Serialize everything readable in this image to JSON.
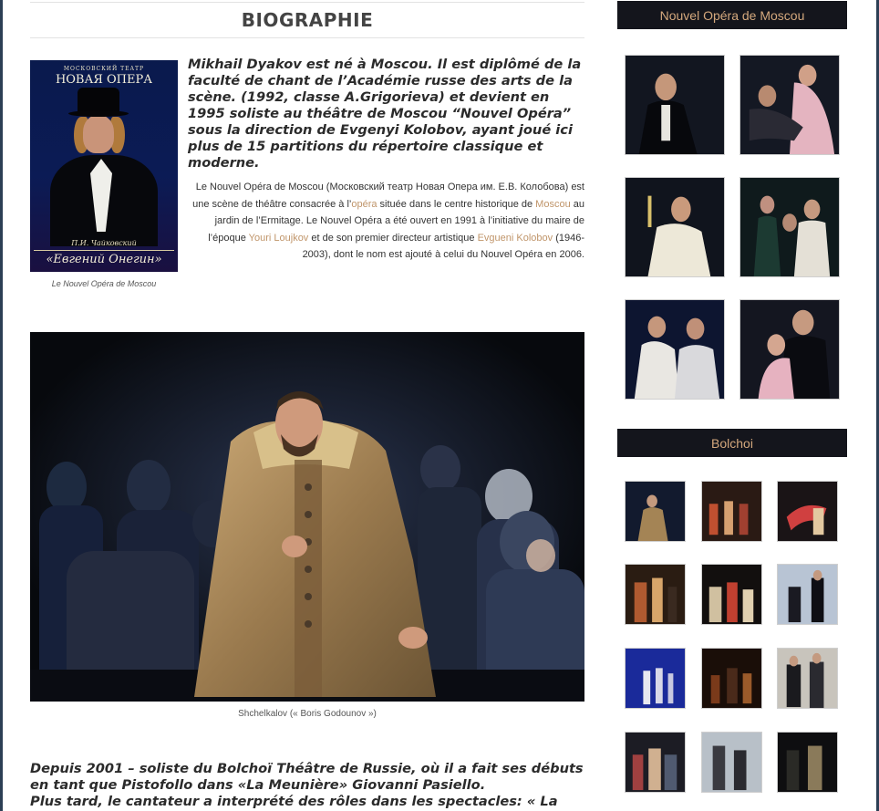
{
  "page": {
    "title": "BIOGRAPHIE"
  },
  "poster": {
    "top_line": "МОСКОВСКИЙ ТЕАТР",
    "title": "НОВАЯ ОПЕРА",
    "composer": "П.И. Чайковский",
    "opera": "«Евгений Онегин»",
    "caption": "Le Nouvel Opéra de Moscou"
  },
  "intro": {
    "lead": "Mikhail Dyakov est né à Moscou. Il est diplômé de la faculté de chant de l’Académie russe des arts de la scène. (1992, classe A.Grigorieva) et devient en 1995 soliste au théâtre de Moscou “Nouvel Opéra” sous la direction de Evgenyi Kolobov, ayant joué ici plus de 15 partitions du répertoire classique et moderne.",
    "desc_1": "Le Nouvel Opéra de Moscou (Московский театр Новая Опера им. Е.В. Колобова) est une scène de théâtre consacrée à l’",
    "link_opera": "opéra",
    "desc_2": " située dans le centre historique de ",
    "link_moscou": "Moscou",
    "desc_3": " au jardin de l’Ermitage. Le Nouvel Opéra a été ouvert en 1991 à l’initiative du maire de l’époque ",
    "link_loujkov": "Youri Loujkov",
    "desc_4": " et de son premier directeur artistique ",
    "link_kolobov": "Evgueni Kolobov",
    "desc_5": " (1946-2003), dont le nom est ajouté à celui du Nouvel Opéra en 2006."
  },
  "hero": {
    "caption": "Shchelkalov (« Boris Godounov »)"
  },
  "bottom": {
    "line_1": "Depuis 2001 – soliste du Bolchoï Théâtre de Russie, où il a fait ses débuts en tant que Pistofollo dans «La Meunière» Giovanni Pasiello.",
    "line_2": "Plus tard, le cantateur a interprété des rôles dans les spectacles: « La Force du"
  },
  "sidebar": {
    "widget_1_title": "Nouvel Opéra de Moscou",
    "widget_2_title": "Bolchoi"
  },
  "colors": {
    "accent": "#c0956a",
    "widget_title_bg": "#14151c",
    "widget_title_text": "#d4a87d"
  }
}
